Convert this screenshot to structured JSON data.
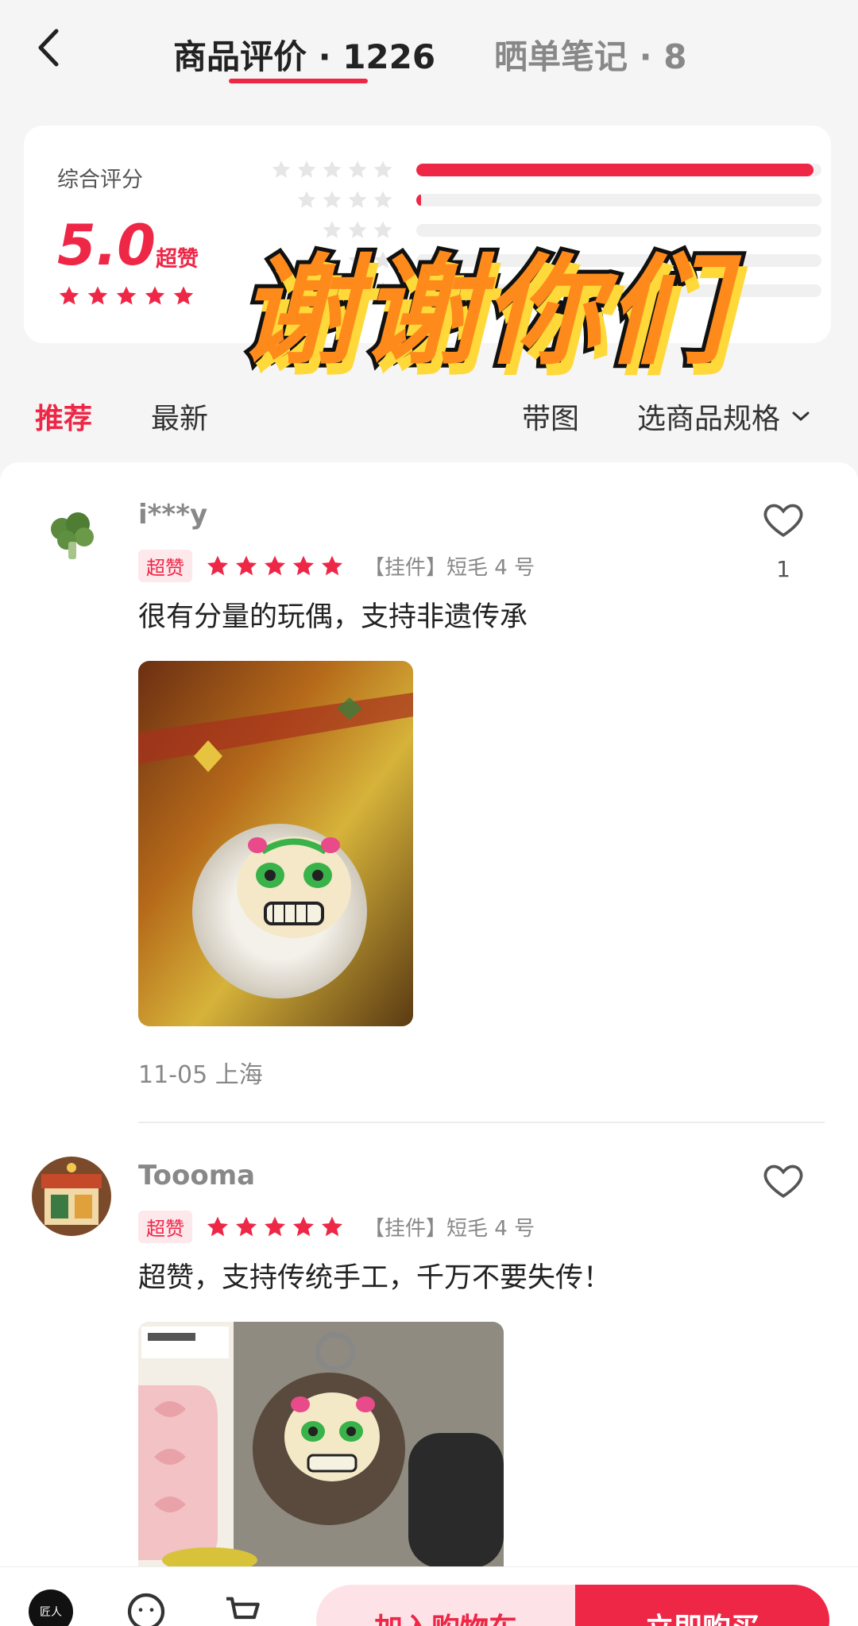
{
  "header": {
    "tab_reviews": "商品评价 · 1226",
    "tab_notes": "晒单笔记 · 8"
  },
  "rating": {
    "label": "综合评分",
    "score": "5.0",
    "score_tag": "超赞",
    "distribution": [
      0.98,
      0.01,
      0.0,
      0.0,
      0.0
    ]
  },
  "overlay_caption": "谢谢你们",
  "filters": {
    "recommend": "推荐",
    "latest": "最新",
    "with_photo": "带图",
    "choose_spec": "选商品规格"
  },
  "reviews": [
    {
      "username": "i***y",
      "tag": "超赞",
      "spec": "【挂件】短毛 4 号",
      "content": "很有分量的玩偶，支持非遗传承",
      "date_location": "11-05 上海",
      "likes": "1"
    },
    {
      "username": "Toooma",
      "tag": "超赞",
      "spec": "【挂件】短毛 4 号",
      "content": "超赞，支持传统手工，千万不要失传！",
      "likes": ""
    }
  ],
  "bottom_bar": {
    "add_to_cart": "加入购物车",
    "buy_now": "立即购买",
    "shop_logo_text": "匠人"
  },
  "colors": {
    "accent": "#ee2747",
    "overlay_fill": "#ff8a1c",
    "overlay_shadow": "#ffd83a"
  }
}
